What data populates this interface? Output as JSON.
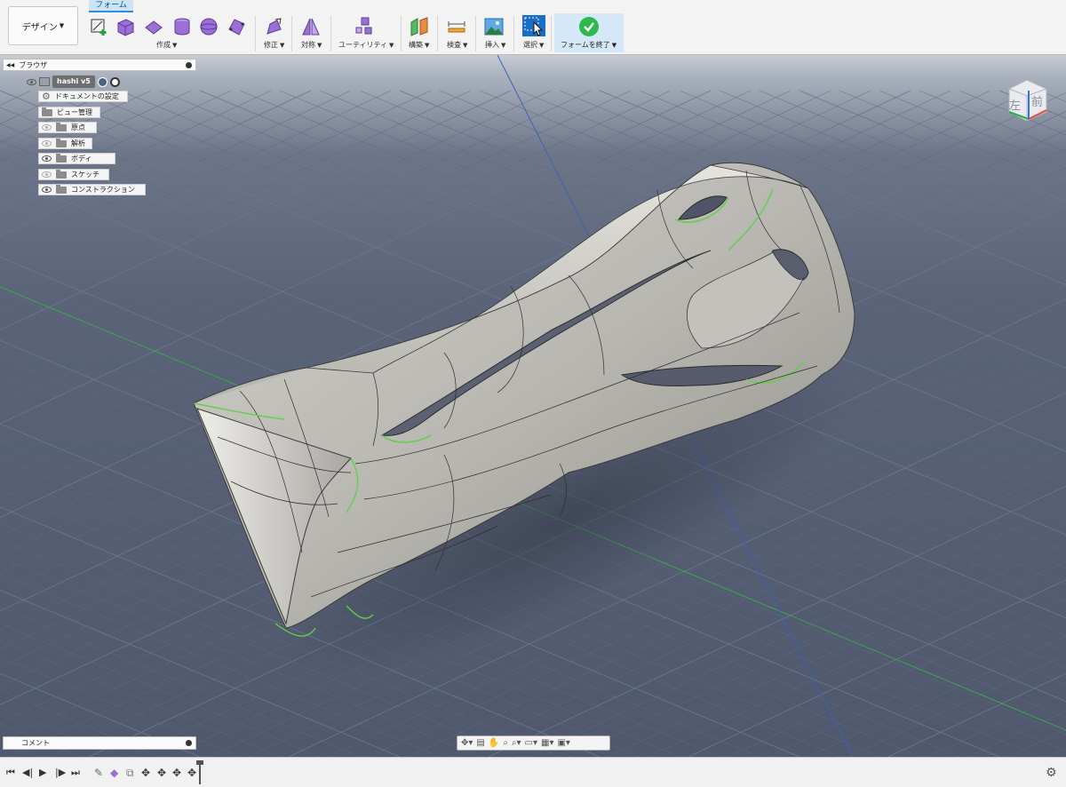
{
  "toolbar": {
    "workspace": "デザイン",
    "active_tab": "フォーム",
    "groups": {
      "create": "作成",
      "modify": "修正",
      "symmetry": "対称",
      "utility": "ユーティリティ",
      "construct": "構築",
      "inspect": "検査",
      "insert": "挿入",
      "select": "選択",
      "finish": "フォームを終了"
    }
  },
  "browser": {
    "title": "ブラウザ",
    "root": "hashi v5",
    "items": [
      {
        "label": "ドキュメントの設定"
      },
      {
        "label": "ビュー管理"
      },
      {
        "label": "原点"
      },
      {
        "label": "解析"
      },
      {
        "label": "ボディ"
      },
      {
        "label": "スケッチ"
      },
      {
        "label": "コンストラクション"
      }
    ]
  },
  "viewcube": {
    "left": "左",
    "front": "前"
  },
  "comments": {
    "label": "コメント"
  },
  "colors": {
    "accent": "#2d8ee0",
    "finish_green": "#2eb84e",
    "form_tool_purple": "#9b6fd6",
    "edge_green": "#5fd04a"
  }
}
